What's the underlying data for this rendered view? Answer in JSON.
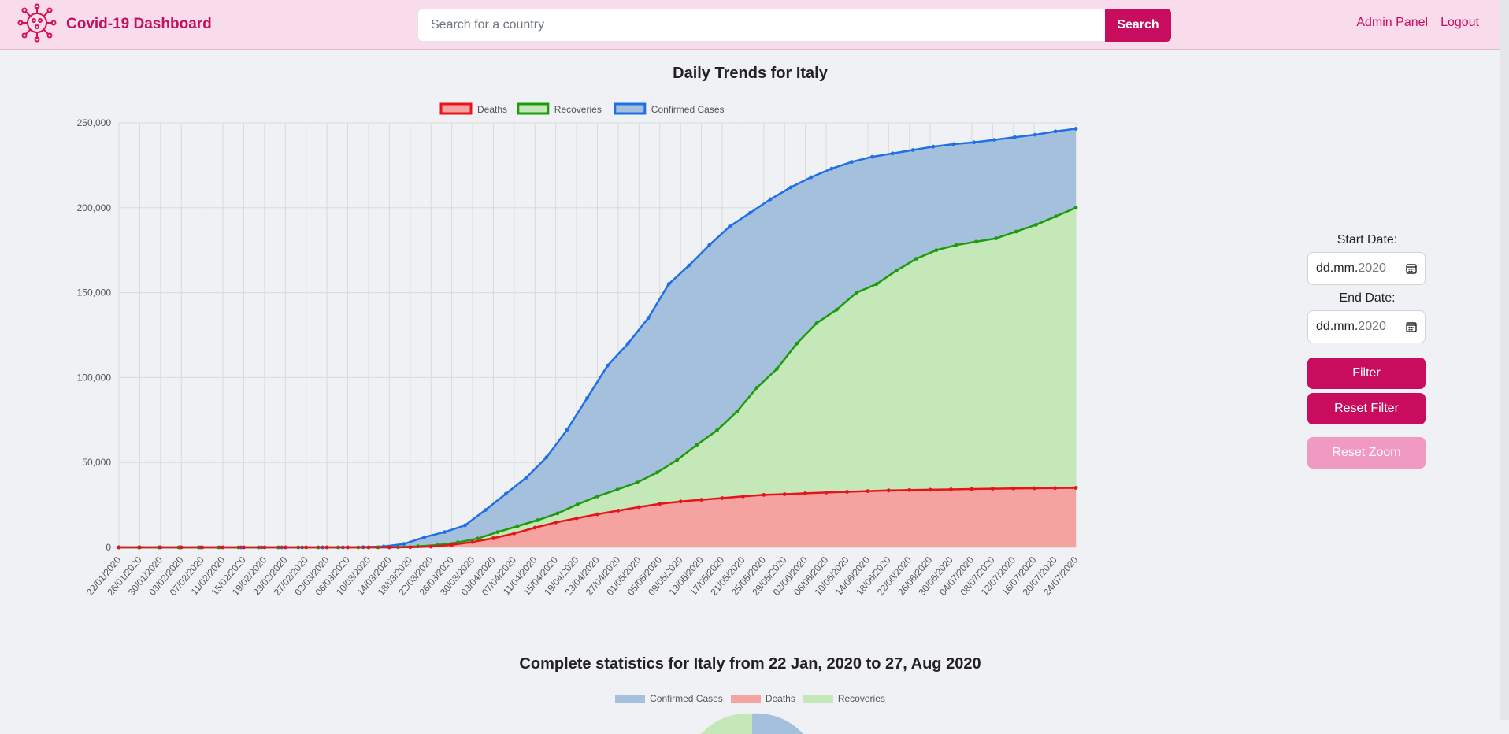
{
  "navbar": {
    "brand": "Covid-19 Dashboard",
    "search_placeholder": "Search for a country",
    "search_button": "Search",
    "links": [
      "Admin Panel",
      "Logout"
    ]
  },
  "chart_title": "Daily Trends for Italy",
  "chart_data": {
    "type": "area",
    "title": "Daily Trends for Italy",
    "legend_position": "top",
    "grid": true,
    "ylim": [
      0,
      250000
    ],
    "y_ticks": [
      "0",
      "50,000",
      "100,000",
      "150,000",
      "200,000",
      "250,000"
    ],
    "x_ticks": [
      "22/01/2020",
      "26/01/2020",
      "30/01/2020",
      "03/02/2020",
      "07/02/2020",
      "11/02/2020",
      "15/02/2020",
      "19/02/2020",
      "23/02/2020",
      "27/02/2020",
      "02/03/2020",
      "06/03/2020",
      "10/03/2020",
      "14/03/2020",
      "18/03/2020",
      "22/03/2020",
      "26/03/2020",
      "30/03/2020",
      "03/04/2020",
      "07/04/2020",
      "11/04/2020",
      "15/04/2020",
      "19/04/2020",
      "23/04/2020",
      "27/04/2020",
      "01/05/2020",
      "05/05/2020",
      "09/05/2020",
      "13/05/2020",
      "17/05/2020",
      "21/05/2020",
      "25/05/2020",
      "29/05/2020",
      "02/06/2020",
      "06/06/2020",
      "10/06/2020",
      "14/06/2020",
      "18/06/2020",
      "22/06/2020",
      "26/06/2020",
      "30/06/2020",
      "04/07/2020",
      "08/07/2020",
      "12/07/2020",
      "16/07/2020",
      "20/07/2020",
      "24/07/2020"
    ],
    "series": [
      {
        "name": "Deaths",
        "line_color": "#e8131a",
        "fill_color": "#f4a3a0",
        "values": [
          0,
          0,
          0,
          0,
          0,
          0,
          0,
          0,
          0,
          0,
          0,
          0,
          0,
          20,
          70,
          460,
          1430,
          3150,
          5400,
          8200,
          11600,
          14700,
          17100,
          19500,
          21600,
          23700,
          25600,
          27000,
          28000,
          29000,
          30000,
          30900,
          31300,
          31800,
          32300,
          32700,
          33100,
          33500,
          33700,
          33900,
          34100,
          34300,
          34500,
          34700,
          34800,
          34900,
          35000
        ]
      },
      {
        "name": "Recoveries",
        "line_color": "#1c9b0c",
        "fill_color": "#c5e8b8",
        "values": [
          0,
          0,
          0,
          0,
          0,
          0,
          0,
          0,
          0,
          0,
          0,
          0,
          0,
          50,
          100,
          600,
          1400,
          2900,
          5200,
          9000,
          12500,
          16000,
          20000,
          25300,
          30000,
          34000,
          38200,
          44100,
          51500,
          60500,
          68900,
          79900,
          94000,
          105000,
          120000,
          132000,
          140000,
          150000,
          155000,
          163000,
          170000,
          175000,
          178000,
          180000,
          182000,
          186000,
          190000,
          195000,
          200000
        ]
      },
      {
        "name": "Confirmed Cases",
        "line_color": "#1f6fe5",
        "fill_color": "#a5c0dd",
        "values": [
          0,
          0,
          0,
          0,
          0,
          0,
          0,
          0,
          0,
          0,
          0,
          0,
          100,
          500,
          2000,
          6000,
          9000,
          13000,
          22000,
          31500,
          41000,
          53000,
          69000,
          88000,
          107000,
          120000,
          135000,
          155000,
          166000,
          178000,
          189000,
          197000,
          205000,
          212000,
          218000,
          223000,
          227000,
          230000,
          232000,
          234000,
          236000,
          237500,
          238500,
          240000,
          241500,
          243000,
          245000,
          246500
        ]
      }
    ]
  },
  "controls": {
    "start_label": "Start Date:",
    "end_label": "End Date:",
    "date_mask": "dd.mm.",
    "date_year": "2020",
    "filter_button": "Filter",
    "reset_filter_button": "Reset Filter",
    "reset_zoom_button": "Reset Zoom"
  },
  "stats_title": "Complete statistics for Italy from 22 Jan, 2020 to 27, Aug 2020",
  "pie_legend": [
    {
      "label": "Confirmed Cases",
      "color": "#a5c0dd"
    },
    {
      "label": "Deaths",
      "color": "#f4a3a0"
    },
    {
      "label": "Recoveries",
      "color": "#c5e8b8"
    }
  ]
}
